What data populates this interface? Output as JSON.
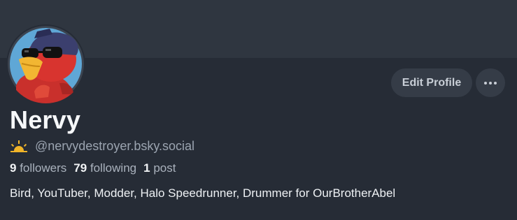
{
  "profile": {
    "display_name": "Nervy",
    "handle": "@nervydestroyer.bsky.social",
    "bio": "Bird, YouTuber, Modder, Halo Speedrunner, Drummer for OurBrotherAbel",
    "stats": {
      "followers_count": "9",
      "followers_label": "followers",
      "following_count": "79",
      "following_label": "following",
      "posts_count": "1",
      "posts_label": "post"
    }
  },
  "actions": {
    "edit_profile_label": "Edit Profile",
    "more_icon": "more-horizontal-icon"
  },
  "icons": {
    "handle_badge": "sunrise-icon",
    "avatar": "red-bird-with-cap-and-sunglasses"
  },
  "colors": {
    "background": "#262c36",
    "banner": "#2f3640",
    "button": "#353c47",
    "muted_text": "#9ba4b0",
    "badge": "#f0b429"
  }
}
